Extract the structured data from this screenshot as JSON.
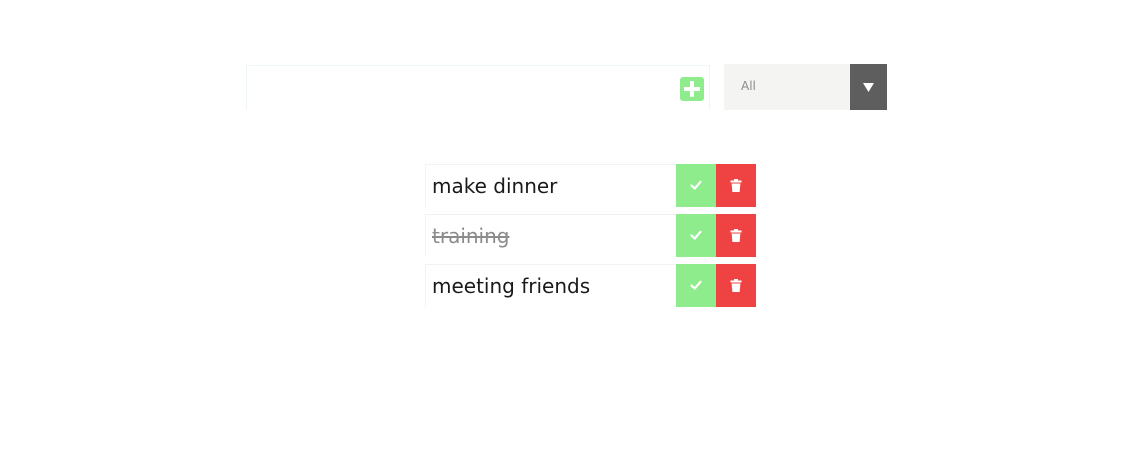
{
  "form": {
    "input_value": "",
    "input_placeholder": "",
    "add_icon": "plus-square-icon",
    "filter": {
      "selected": "All",
      "arrow_icon": "caret-down-icon"
    }
  },
  "todos": [
    {
      "text": "make dinner",
      "completed": false
    },
    {
      "text": "training",
      "completed": true
    },
    {
      "text": "meeting friends",
      "completed": false
    }
  ],
  "icons": {
    "complete": "check-icon",
    "delete": "trash-icon"
  },
  "colors": {
    "add_accent": "#8fec8c",
    "complete_bg": "#8fec8c",
    "delete_bg": "#ef4343",
    "filter_bg": "#f4f4f2",
    "filter_arrow_bg": "#5e5e5e",
    "completed_text": "#8c8c8c"
  }
}
